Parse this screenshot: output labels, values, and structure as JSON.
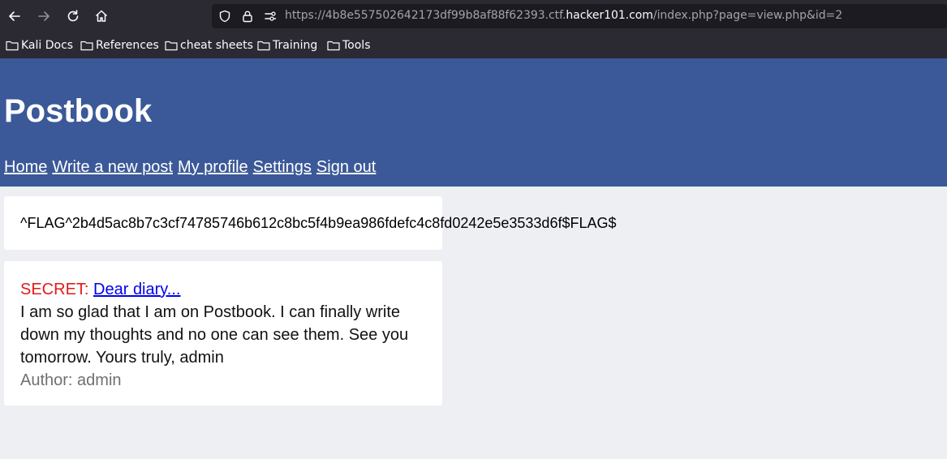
{
  "browser": {
    "url_prefix": "https://4b8e557502642173df99b8af88f62393.ctf.",
    "url_domain": "hacker101.com",
    "url_path": "/index.php?page=view.php&id=2",
    "bookmarks": [
      "Kali Docs",
      "References",
      "cheat sheets",
      "Training",
      "Tools"
    ]
  },
  "site": {
    "title": "Postbook",
    "nav": [
      "Home",
      "Write a new post",
      "My profile",
      "Settings",
      "Sign out"
    ]
  },
  "flag": {
    "text": "^FLAG^2b4d5ac8b7c3cf74785746b612c8bc5f4b9ea986fdefc4c8fd0242e5e3533d6f$FLAG$"
  },
  "post": {
    "prefix": "SECRET:",
    "title": "Dear diary...",
    "body": "I am so glad that I am on Postbook. I can finally write down my thoughts and no one can see them. See you tomorrow. Yours truly, admin",
    "author_label": "Author:",
    "author": "admin"
  },
  "colors": {
    "header_bg": "#3b5998",
    "page_bg": "#edeff3",
    "secret_red": "#e01b1b",
    "link_blue": "#0000ee"
  }
}
